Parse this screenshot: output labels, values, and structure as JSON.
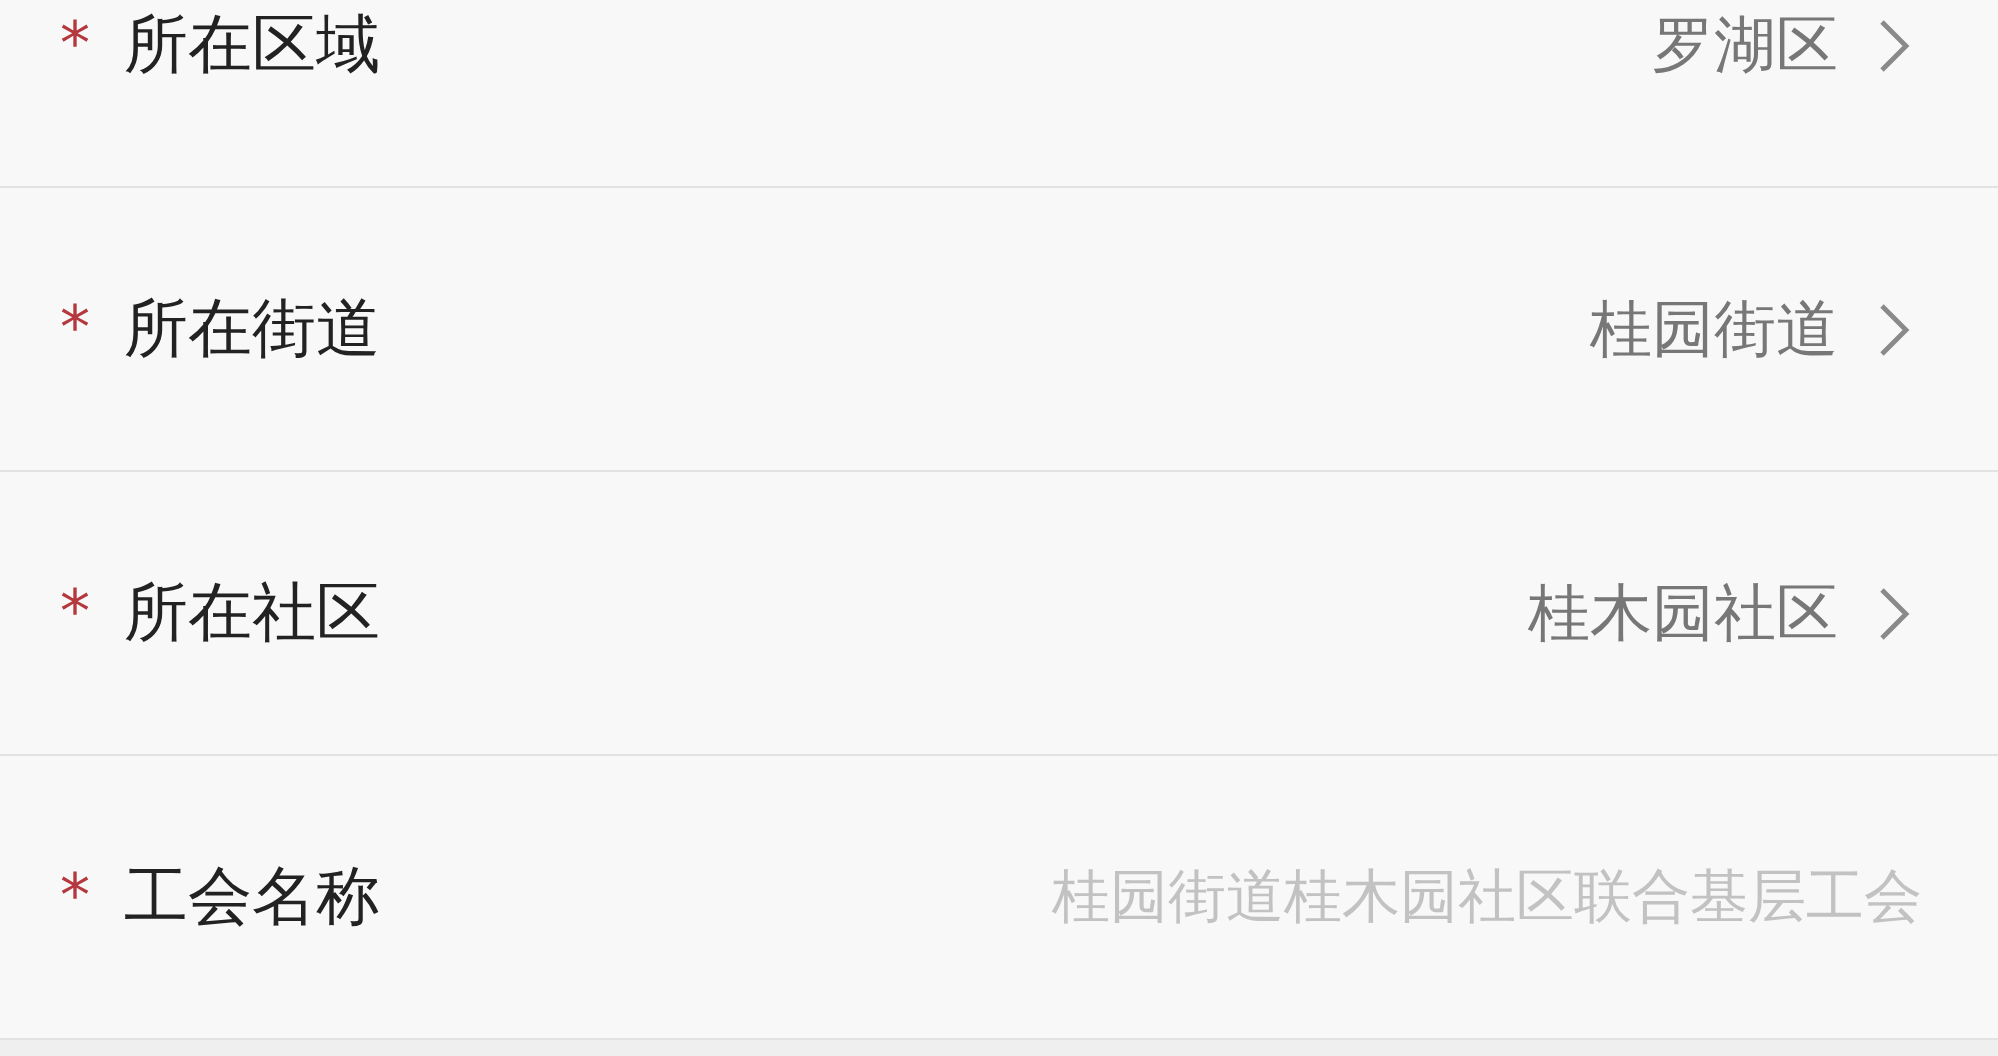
{
  "form_rows": [
    {
      "label": "所在区域",
      "required_mark": "*",
      "kind": "select",
      "value": "罗湖区"
    },
    {
      "label": "所在街道",
      "required_mark": "*",
      "kind": "select",
      "value": "桂园街道"
    },
    {
      "label": "所在社区",
      "required_mark": "*",
      "kind": "select",
      "value": "桂木园社区"
    },
    {
      "label": "工会名称",
      "required_mark": "*",
      "kind": "readonly",
      "value": "桂园街道桂木园社区联合基层工会"
    }
  ]
}
